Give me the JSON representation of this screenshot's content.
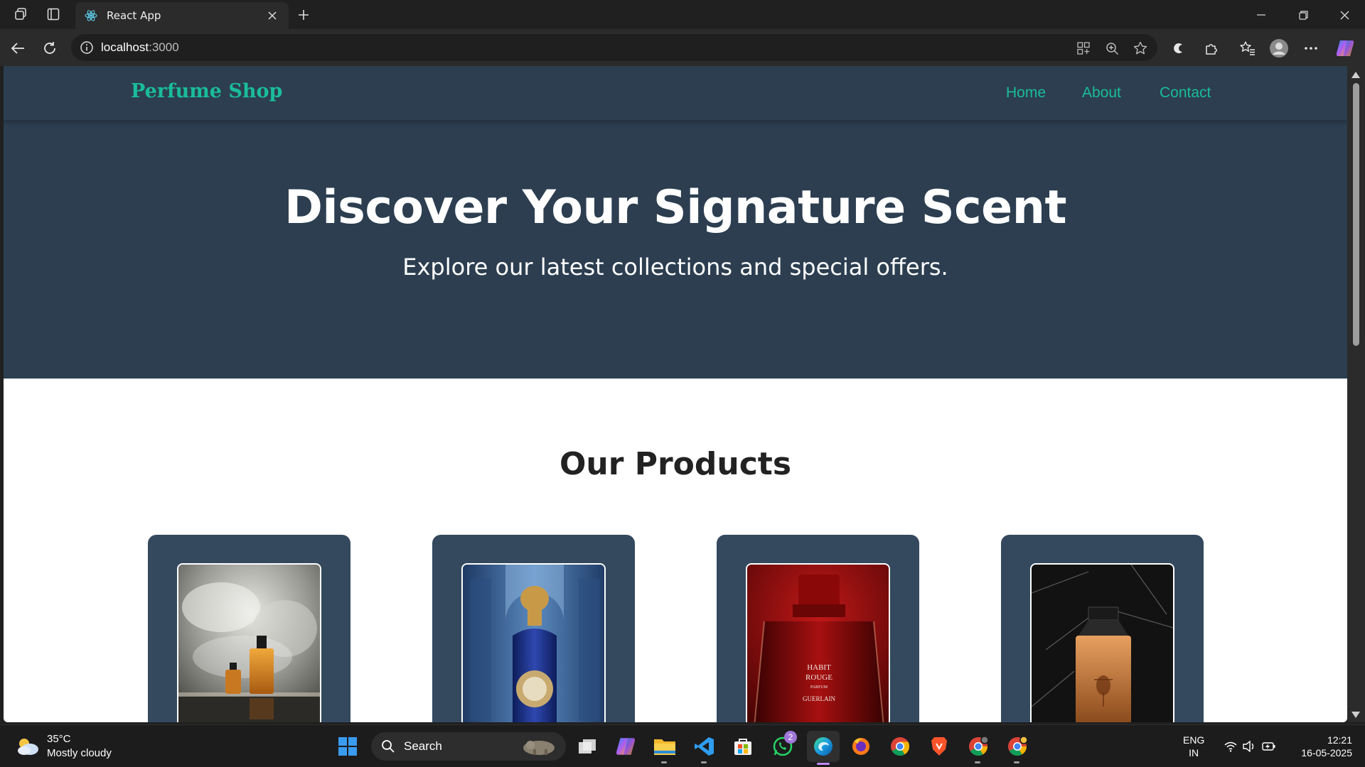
{
  "browser": {
    "tab_title": "React App",
    "url_host": "localhost",
    "url_port": ":3000"
  },
  "site": {
    "logo": "Perfume Shop",
    "nav": [
      "Home",
      "About",
      "Contact"
    ],
    "hero_title": "Discover Your Signature Scent",
    "hero_subtitle": "Explore our latest collections and special offers.",
    "products_title": "Our Products",
    "products": [
      {
        "image": "perfume-bottle-smoke-photo"
      },
      {
        "image": "blue-perfume-bottle-photo"
      },
      {
        "image": "red-perfume-bottle-photo",
        "label_text": "HABIT ROUGE PARFUM GUERLAIN"
      },
      {
        "image": "amber-perfume-bottle-photo"
      }
    ]
  },
  "taskbar": {
    "weather_temp": "35°C",
    "weather_desc": "Mostly cloudy",
    "search_placeholder": "Search",
    "whatsapp_badge": "2",
    "lang_1": "ENG",
    "lang_2": "IN",
    "time": "12:21",
    "date": "16-05-2025"
  },
  "colors": {
    "nav_bg": "#2c3e50",
    "accent": "#1abc9c",
    "card_bg": "#34495e"
  }
}
